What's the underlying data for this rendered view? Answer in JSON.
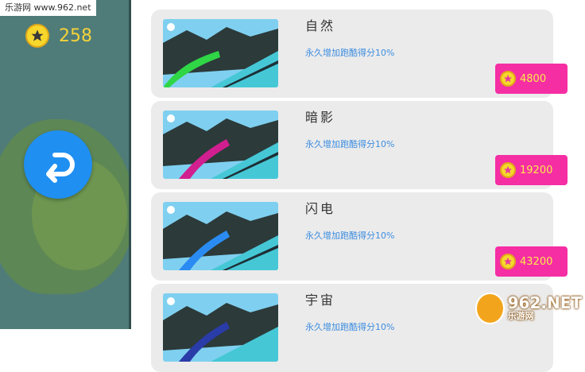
{
  "watermark": {
    "top_left": "乐游网 www.962.net",
    "bottom_right_big": "962.NET",
    "bottom_right_small": "乐游网"
  },
  "wallet": {
    "coins": "258",
    "coin_icon": "star-coin-icon"
  },
  "back": {
    "icon": "return-arrow-icon"
  },
  "skins": [
    {
      "name": "自然",
      "desc": "永久增加跑酷得分10%",
      "price": "4800",
      "trail_color": "#2fd646"
    },
    {
      "name": "暗影",
      "desc": "永久增加跑酷得分10%",
      "price": "19200",
      "trail_color": "#d11f8f"
    },
    {
      "name": "闪电",
      "desc": "永久增加跑酷得分10%",
      "price": "43200",
      "trail_color": "#2a8cf2"
    },
    {
      "name": "宇宙",
      "desc": "永久增加跑酷得分10%",
      "price": "",
      "trail_color": "#2a3ca8"
    }
  ],
  "colors": {
    "price_button": "#f52ea4",
    "price_text": "#ffe94a",
    "desc_text": "#3d8de0",
    "back_button": "#1f8ff2",
    "panel": "#4f7c79"
  }
}
